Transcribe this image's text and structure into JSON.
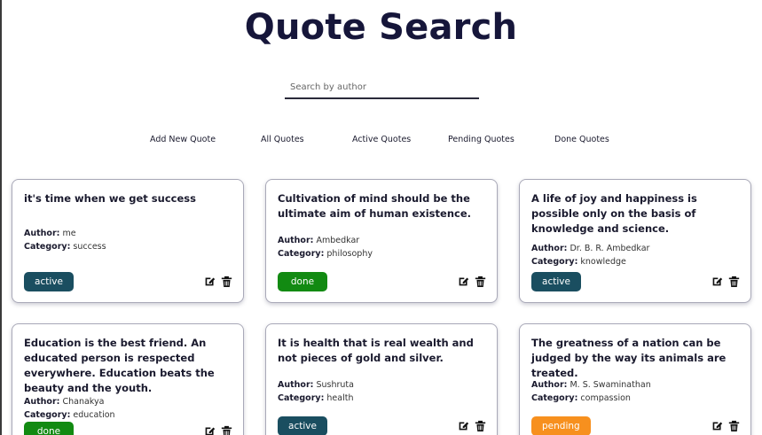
{
  "page": {
    "title": "Quote Search"
  },
  "search": {
    "placeholder": "Search by author",
    "value": ""
  },
  "nav": {
    "add_new": "Add New Quote",
    "all": "All Quotes",
    "active": "Active Quotes",
    "pending": "Pending Quotes",
    "done": "Done Quotes"
  },
  "labels": {
    "author": "Author:",
    "category": "Category:"
  },
  "status_colors": {
    "active": "#1a4e60",
    "done": "#128a12",
    "pending": "#f7901e"
  },
  "icons": {
    "edit": "edit-icon",
    "delete": "trash-icon"
  },
  "quotes": [
    {
      "text": "it's time when we get success",
      "author": "me",
      "category": "success",
      "status": "active"
    },
    {
      "text": "Cultivation of mind should be the ultimate aim of human existence.",
      "author": "Ambedkar",
      "category": "philosophy",
      "status": "done"
    },
    {
      "text": "A life of joy and happiness is possible only on the basis of knowledge and science.",
      "author": "Dr. B. R. Ambedkar",
      "category": "knowledge",
      "status": "active"
    },
    {
      "text": "Education is the best friend. An educated person is respected everywhere. Education beats the beauty and the youth.",
      "author": "Chanakya",
      "category": "education",
      "status": "done"
    },
    {
      "text": "It is health that is real wealth and not pieces of gold and silver.",
      "author": "Sushruta",
      "category": "health",
      "status": "active"
    },
    {
      "text": "The greatness of a nation can be judged by the way its animals are treated.",
      "author": "M. S. Swaminathan",
      "category": "compassion",
      "status": "pending"
    }
  ]
}
